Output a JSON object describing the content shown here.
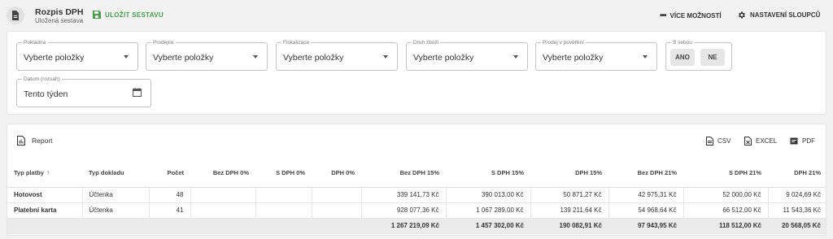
{
  "header": {
    "title": "Rozpis DPH",
    "subtitle": "Uložená sestava",
    "save_label": "ULOŽIT SESTAVU",
    "more_label": "VÍCE MOŽNOSTÍ",
    "columns_label": "NASTAVENÍ SLOUPCŮ"
  },
  "filters": {
    "pokladna": {
      "label": "Pokladna",
      "value": "Vyberte položky"
    },
    "prodejce": {
      "label": "Prodejce",
      "value": "Vyberte položky"
    },
    "fiskalizace": {
      "label": "Fiskalizace",
      "value": "Vyberte položky"
    },
    "druh_zbozi": {
      "label": "Druh zboží",
      "value": "Vyberte položky"
    },
    "prodej_v_povereni": {
      "label": "Prodej v pověření",
      "value": "Vyberte položky"
    },
    "s_sebou": {
      "label": "S sebou",
      "yes": "ANO",
      "no": "NE"
    },
    "datum": {
      "label": "Datum (rozsah)",
      "value": "Tento týden"
    }
  },
  "report": {
    "title": "Report",
    "export": {
      "csv": "CSV",
      "excel": "EXCEL",
      "pdf": "PDF"
    },
    "columns": [
      "Typ platby",
      "Typ dokladu",
      "Počet",
      "Bez DPH 0%",
      "S DPH 0%",
      "DPH 0%",
      "Bez DPH 15%",
      "S DPH 15%",
      "DPH 15%",
      "Bez DPH 21%",
      "S DPH 21%",
      "DPH 21%"
    ],
    "sort_arrow": "↑",
    "rows": [
      [
        "Hotovost",
        "Účtenka",
        "48",
        "",
        "",
        "",
        "339 141,73 Kč",
        "390 013,00 Kč",
        "50 871,27 Kč",
        "42 975,31 Kč",
        "52 000,00 Kč",
        "9 024,69 Kč"
      ],
      [
        "Platební karta",
        "Účtenka",
        "41",
        "",
        "",
        "",
        "928 077,36 Kč",
        "1 067 289,00 Kč",
        "139 211,64 Kč",
        "54 968,64 Kč",
        "66 512,00 Kč",
        "11 543,36 Kč"
      ]
    ],
    "totals": [
      "",
      "",
      "",
      "",
      "",
      "",
      "1 267 219,09 Kč",
      "1 457 302,00 Kč",
      "190 082,91 Kč",
      "97 943,95 Kč",
      "118 512,00 Kč",
      "20 568,05 Kč"
    ]
  },
  "colors": {
    "accent": "#43a047",
    "background": "#f2f2f2"
  }
}
